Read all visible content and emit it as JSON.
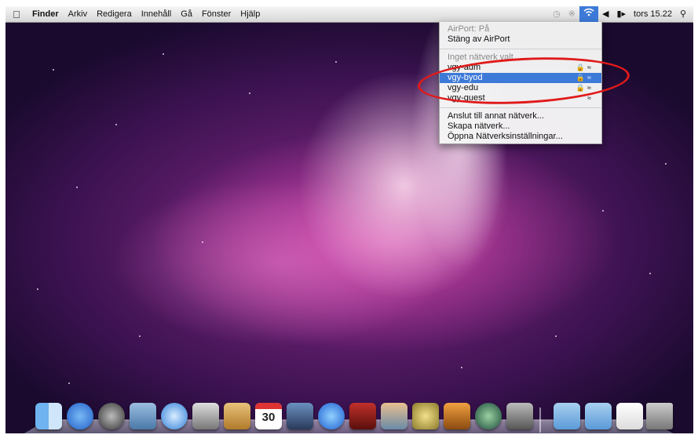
{
  "menubar": {
    "app_name": "Finder",
    "items": [
      "Arkiv",
      "Redigera",
      "Innehåll",
      "Gå",
      "Fönster",
      "Hjälp"
    ],
    "clock": "tors 15.22"
  },
  "airport_menu": {
    "status": "AirPort: På",
    "toggle_label": "Stäng av AirPort",
    "no_network": "Inget nätverk valt",
    "networks": [
      {
        "name": "vgy-adm",
        "secured": true
      },
      {
        "name": "vgy-byod",
        "secured": true,
        "selected": true
      },
      {
        "name": "vgy-edu",
        "secured": true
      },
      {
        "name": "vgy-guest",
        "secured": false
      }
    ],
    "actions": [
      "Anslut till annat nätverk...",
      "Skapa nätverk...",
      "Öppna Nätverksinställningar..."
    ]
  },
  "dock": {
    "calendar_day": "30"
  },
  "colors": {
    "highlight": "#3d7ad8",
    "annotation": "#e01a1a"
  }
}
